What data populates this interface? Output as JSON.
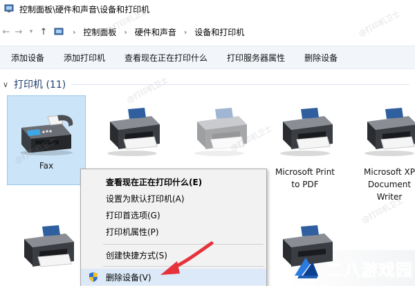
{
  "window": {
    "title": "控制面板\\硬件和声音\\设备和打印机"
  },
  "address": {
    "crumbs": [
      "控制面板",
      "硬件和声音",
      "设备和打印机"
    ]
  },
  "toolbar": {
    "buttons": [
      "添加设备",
      "添加打印机",
      "查看现在正在打印什么",
      "打印服务器属性",
      "删除设备"
    ]
  },
  "group": {
    "label": "打印机 (11)"
  },
  "devices": [
    {
      "label": "Fax",
      "icon": "fax-icon",
      "selected": true
    },
    {
      "label": "",
      "icon": "printer-icon"
    },
    {
      "label": "",
      "icon": "printer-icon"
    },
    {
      "label": "",
      "icon": "printer-icon"
    },
    {
      "label_line1": "Microsoft Print",
      "label_line2": "to PDF",
      "icon": "printer-icon"
    },
    {
      "label_line1": "Microsoft XP",
      "label_line2": "Document",
      "label_line3": "Writer",
      "icon": "printer-icon"
    }
  ],
  "context_menu": {
    "items": [
      {
        "label": "查看现在正在打印什么(E)",
        "bold": true
      },
      {
        "label": "设置为默认打印机(A)"
      },
      {
        "label": "打印首选项(G)"
      },
      {
        "label": "打印机属性(P)"
      },
      {
        "label": "创建快捷方式(S)"
      },
      {
        "label": "删除设备(V)",
        "icon": "shield-icon"
      }
    ]
  },
  "watermark": {
    "text": "@打印机卫士"
  },
  "brand": {
    "text": "二八游戏园"
  },
  "colors": {
    "accent": "#1e3d6b",
    "selection": "#cce4f7",
    "arrow": "#e5323b"
  }
}
